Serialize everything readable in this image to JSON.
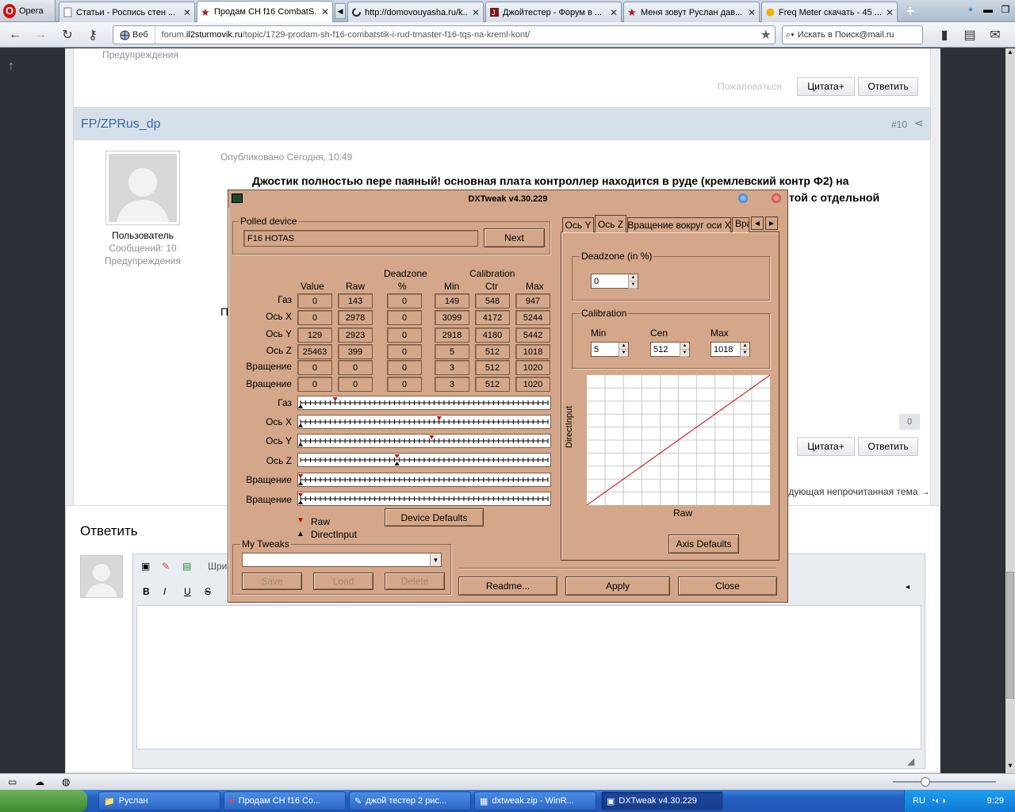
{
  "browser": {
    "menu_label": "Opera",
    "tabs": [
      {
        "label": "Статьи - Роспись стен ...",
        "icon": "doc-icon"
      },
      {
        "label": "Продам CH f16 CombatS...",
        "icon": "star-icon",
        "active": true
      },
      {
        "label": "http://domovouyasha.ru/k...",
        "icon": "loading-icon"
      },
      {
        "label": "Джойтестер - Форум в ...",
        "icon": "forum-icon"
      },
      {
        "label": "Меня зовут Руслан дав...",
        "icon": "star-icon"
      },
      {
        "label": "Freq Meter скачать - 45 ...",
        "icon": "freq-icon"
      }
    ],
    "address": {
      "web_label": "Веб",
      "url_prefix": "forum.",
      "url_domain": "il2sturmovik.ru",
      "url_path": "/topic/1729-prodam-sh-f16-combatstik-i-rud-tmaster-f16-tqs-na-kreml-kont/"
    },
    "search_placeholder": "Искать в Поиск@mail.ru"
  },
  "forum": {
    "prev_post": {
      "warnings": "Предупреждения",
      "report": "Пожаловаться",
      "quote": "Цитата+",
      "reply": "Ответить"
    },
    "post": {
      "author": "FP/ZPRus_dp",
      "number": "#10",
      "role": "Пользователь",
      "messages": "Сообщений: 10",
      "warnings": "Предупреждения",
      "published": "Опубликовано Сегодня, 10:49",
      "text_line1": "Джостик полностью пере паяный! основная плата контроллер находится в руде (кремлевский контр Ф2) на",
      "text_line2_tail": "той с отдельной",
      "partial_left_char": "П",
      "likes": "0",
      "quote": "Цитата+",
      "reply": "Ответить"
    },
    "next_unread": "едующая непрочитанная тема →",
    "reply_box": {
      "title": "Ответить",
      "font_placeholder": "Шри"
    }
  },
  "dxtweak": {
    "title": "DXTweak v4.30.229",
    "polled_device_label": "Polled device",
    "device_name": "F16 HOTAS",
    "next_btn": "Next",
    "headers": {
      "value": "Value",
      "raw": "Raw",
      "deadzone": "Deadzone",
      "deadzone_pct": "%",
      "calibration": "Calibration",
      "min": "Min",
      "ctr": "Ctr",
      "max": "Max"
    },
    "axes": [
      {
        "name": "Газ",
        "value": "0",
        "raw": "143",
        "dz": "0",
        "min": "149",
        "ctr": "548",
        "max": "947",
        "raw_pos": 0.14,
        "di_pos": 0.0
      },
      {
        "name": "Ось X",
        "value": "0",
        "raw": "2978",
        "dz": "0",
        "min": "3099",
        "ctr": "4172",
        "max": "5244",
        "raw_pos": 0.56,
        "di_pos": 0.0
      },
      {
        "name": "Ось Y",
        "value": "129",
        "raw": "2923",
        "dz": "0",
        "min": "2918",
        "ctr": "4180",
        "max": "5442",
        "raw_pos": 0.53,
        "di_pos": 0.0
      },
      {
        "name": "Ось Z",
        "value": "25463",
        "raw": "399",
        "dz": "0",
        "min": "5",
        "ctr": "512",
        "max": "1018",
        "raw_pos": 0.39,
        "di_pos": 0.39
      },
      {
        "name": "Вращение",
        "value": "0",
        "raw": "0",
        "dz": "0",
        "min": "3",
        "ctr": "512",
        "max": "1020",
        "raw_pos": 0.0,
        "di_pos": 0.0
      },
      {
        "name": "Вращение",
        "value": "0",
        "raw": "0",
        "dz": "0",
        "min": "3",
        "ctr": "512",
        "max": "1020",
        "raw_pos": 0.0,
        "di_pos": 0.0
      }
    ],
    "device_defaults_btn": "Device Defaults",
    "legend_raw": "Raw",
    "legend_di": "DirectInput",
    "my_tweaks_label": "My Tweaks",
    "save_btn": "Save",
    "load_btn": "Load",
    "delete_btn": "Delete",
    "readme_btn": "Readme...",
    "apply_btn": "Apply",
    "close_btn": "Close",
    "tabs": [
      "Ось Y",
      "Ось Z",
      "Вращение вокруг оси X",
      "Вра"
    ],
    "active_tab": "Ось Z",
    "deadzone_group": "Deadzone (in %)",
    "deadzone_value": "0",
    "calibration_group": "Calibration",
    "cal_min_label": "Min",
    "cal_min": "5",
    "cal_cen_label": "Cen",
    "cal_cen": "512",
    "cal_max_label": "Max",
    "cal_max": "1018",
    "graph_y_label": "DirectInput",
    "graph_x_label": "Raw",
    "axis_defaults_btn": "Axis Defaults"
  },
  "statusbar": {
    "zoom_hint": ""
  },
  "taskbar": {
    "tasks": [
      {
        "label": "Руслан"
      },
      {
        "label": "Продам CH f16 Co..."
      },
      {
        "label": "джой тестер 2 рис..."
      },
      {
        "label": "dxtweak.zip - WinR..."
      },
      {
        "label": "DXTweak v4.30.229",
        "active": true
      }
    ],
    "lang": "RU",
    "clock": "9:29"
  },
  "colors": {
    "window_bg": "#d4a78a",
    "graph_line": "#cc0000",
    "raw_marker": "#cc0000",
    "di_marker": "#000000"
  }
}
